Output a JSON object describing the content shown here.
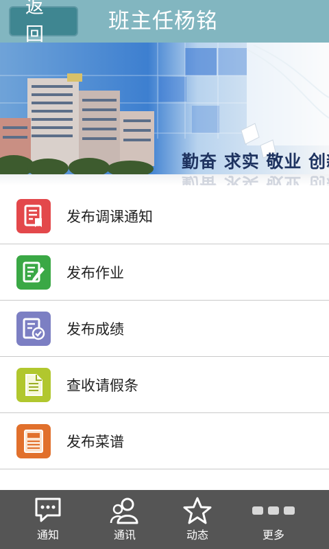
{
  "header": {
    "back_label": "返回",
    "title": "班主任杨铭"
  },
  "banner": {
    "slogan": "勤奋 求实 敬业 创新"
  },
  "menu": {
    "items": [
      {
        "label": "发布调课通知",
        "icon": "schedule-notice-icon",
        "color": "#e3484b"
      },
      {
        "label": "发布作业",
        "icon": "homework-pen-icon",
        "color": "#3aa845"
      },
      {
        "label": "发布成绩",
        "icon": "grades-check-icon",
        "color": "#7c7fc3"
      },
      {
        "label": "查收请假条",
        "icon": "leave-note-icon",
        "color": "#b1c72e"
      },
      {
        "label": "发布菜谱",
        "icon": "food-menu-icon",
        "color": "#e1702c"
      }
    ]
  },
  "tabbar": {
    "items": [
      {
        "label": "通知",
        "icon": "chat-bubble-icon"
      },
      {
        "label": "通讯",
        "icon": "contacts-icon"
      },
      {
        "label": "动态",
        "icon": "star-icon"
      },
      {
        "label": "更多",
        "icon": "more-dots-icon"
      }
    ]
  },
  "colors": {
    "titlebar": "#82b6c0",
    "back_button": "#3f8691",
    "tabbar": "#555555"
  }
}
